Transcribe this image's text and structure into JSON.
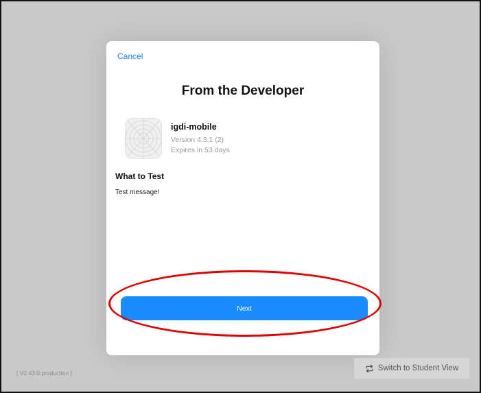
{
  "modal": {
    "cancel_label": "Cancel",
    "title": "From the Developer",
    "app": {
      "icon": "app-target-icon",
      "name": "igdi-mobile",
      "version": "Version 4.3.1 (2)",
      "expiry": "Expires in 53 days"
    },
    "what_to_test": {
      "heading": "What to Test",
      "body": "Test message!"
    },
    "next_label": "Next"
  },
  "footer": {
    "version_tag": "[ V2.43.0:production ]",
    "switch_label": "Switch to Student View",
    "switch_icon": "repeat-arrows-icon"
  },
  "colors": {
    "accent": "#1a8cff",
    "link": "#1a7ee8",
    "highlight": "#e00000",
    "backdrop": "#c9c9c9"
  }
}
